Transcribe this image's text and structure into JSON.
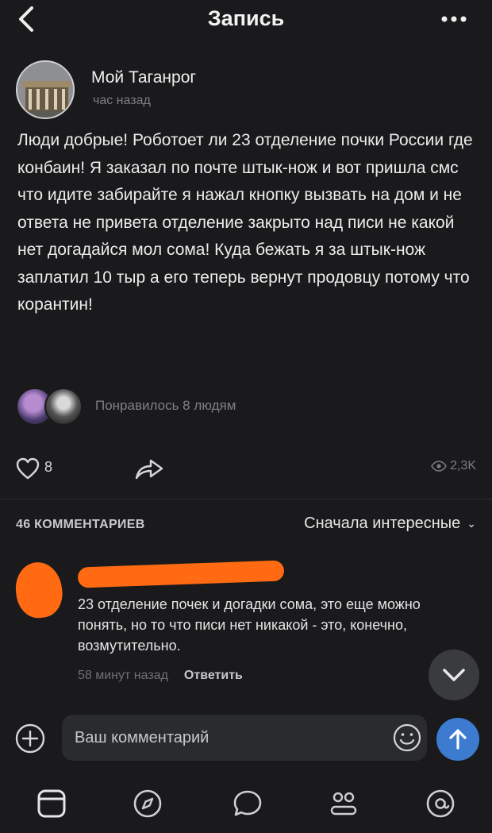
{
  "header": {
    "title": "Запись",
    "back_icon": "chevron-left-icon",
    "more_icon": "more-dots-icon"
  },
  "post": {
    "group_name": "Мой Таганрог",
    "time": "час назад",
    "text": "Люди добрые! Роботоет ли 23 отделение почки России где конбаин! Я заказал по почте штык-нож и вот пришла смс что идите забирайте я нажал кнопку вызвать на дом и не ответа не привета отделение закрыто над писи не какой нет догадайся мол сома! Куда бежать я за штык-нож заплатил 10 тыр а его теперь вернут продовцу потому что корантин!",
    "likers_text": "Понравилось 8 людям",
    "like_count": "8",
    "views": "2,3K"
  },
  "comments": {
    "count_label": "46 КОММЕНТАРИЕВ",
    "sort_label": "Сначала интересные",
    "items": [
      {
        "text": "23 отделение почек и догадки сома, это еще можно понять, но то что писи нет никакой - это, конечно, возмутительно.",
        "time": "58 минут назад",
        "reply_label": "Ответить"
      }
    ]
  },
  "input": {
    "placeholder": "Ваш комментарий"
  },
  "tabbar": {
    "icons": [
      "news-icon",
      "discover-icon",
      "messages-icon",
      "friends-icon",
      "profile-icon"
    ]
  },
  "colors": {
    "background": "#1a1a1c",
    "accent": "#3c7bd0",
    "redaction": "#ff6a13"
  }
}
